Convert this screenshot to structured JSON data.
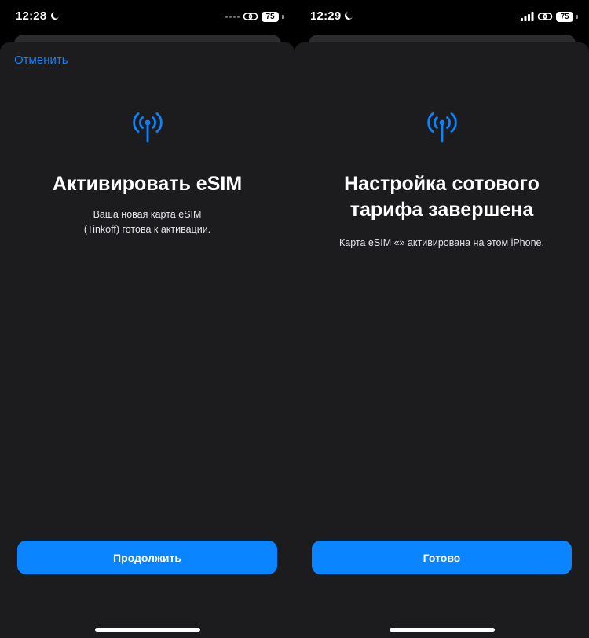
{
  "screens": [
    {
      "status": {
        "time": "12:28",
        "battery": "75"
      },
      "cancel_label": "Отменить",
      "icons": [
        "antenna-icon",
        "moon-icon",
        "link-icon"
      ],
      "title_lines": [
        "Активировать eSIM"
      ],
      "subtitle_lines": [
        "Ваша новая карта eSIM",
        "(Tinkoff) готова к активации."
      ],
      "button_label": "Продолжить"
    },
    {
      "status": {
        "time": "12:29",
        "battery": "75"
      },
      "icons": [
        "antenna-icon",
        "moon-icon",
        "cellular-signal-icon",
        "link-icon"
      ],
      "title_lines": [
        "Настройка сотового",
        "тарифа завершена"
      ],
      "subtitle_lines": [
        "Карта eSIM «» активирована на этом iPhone."
      ],
      "button_label": "Готово"
    }
  ],
  "colors": {
    "accent": "#0a84ff",
    "sheet": "#1c1c1e",
    "background": "#000000"
  }
}
